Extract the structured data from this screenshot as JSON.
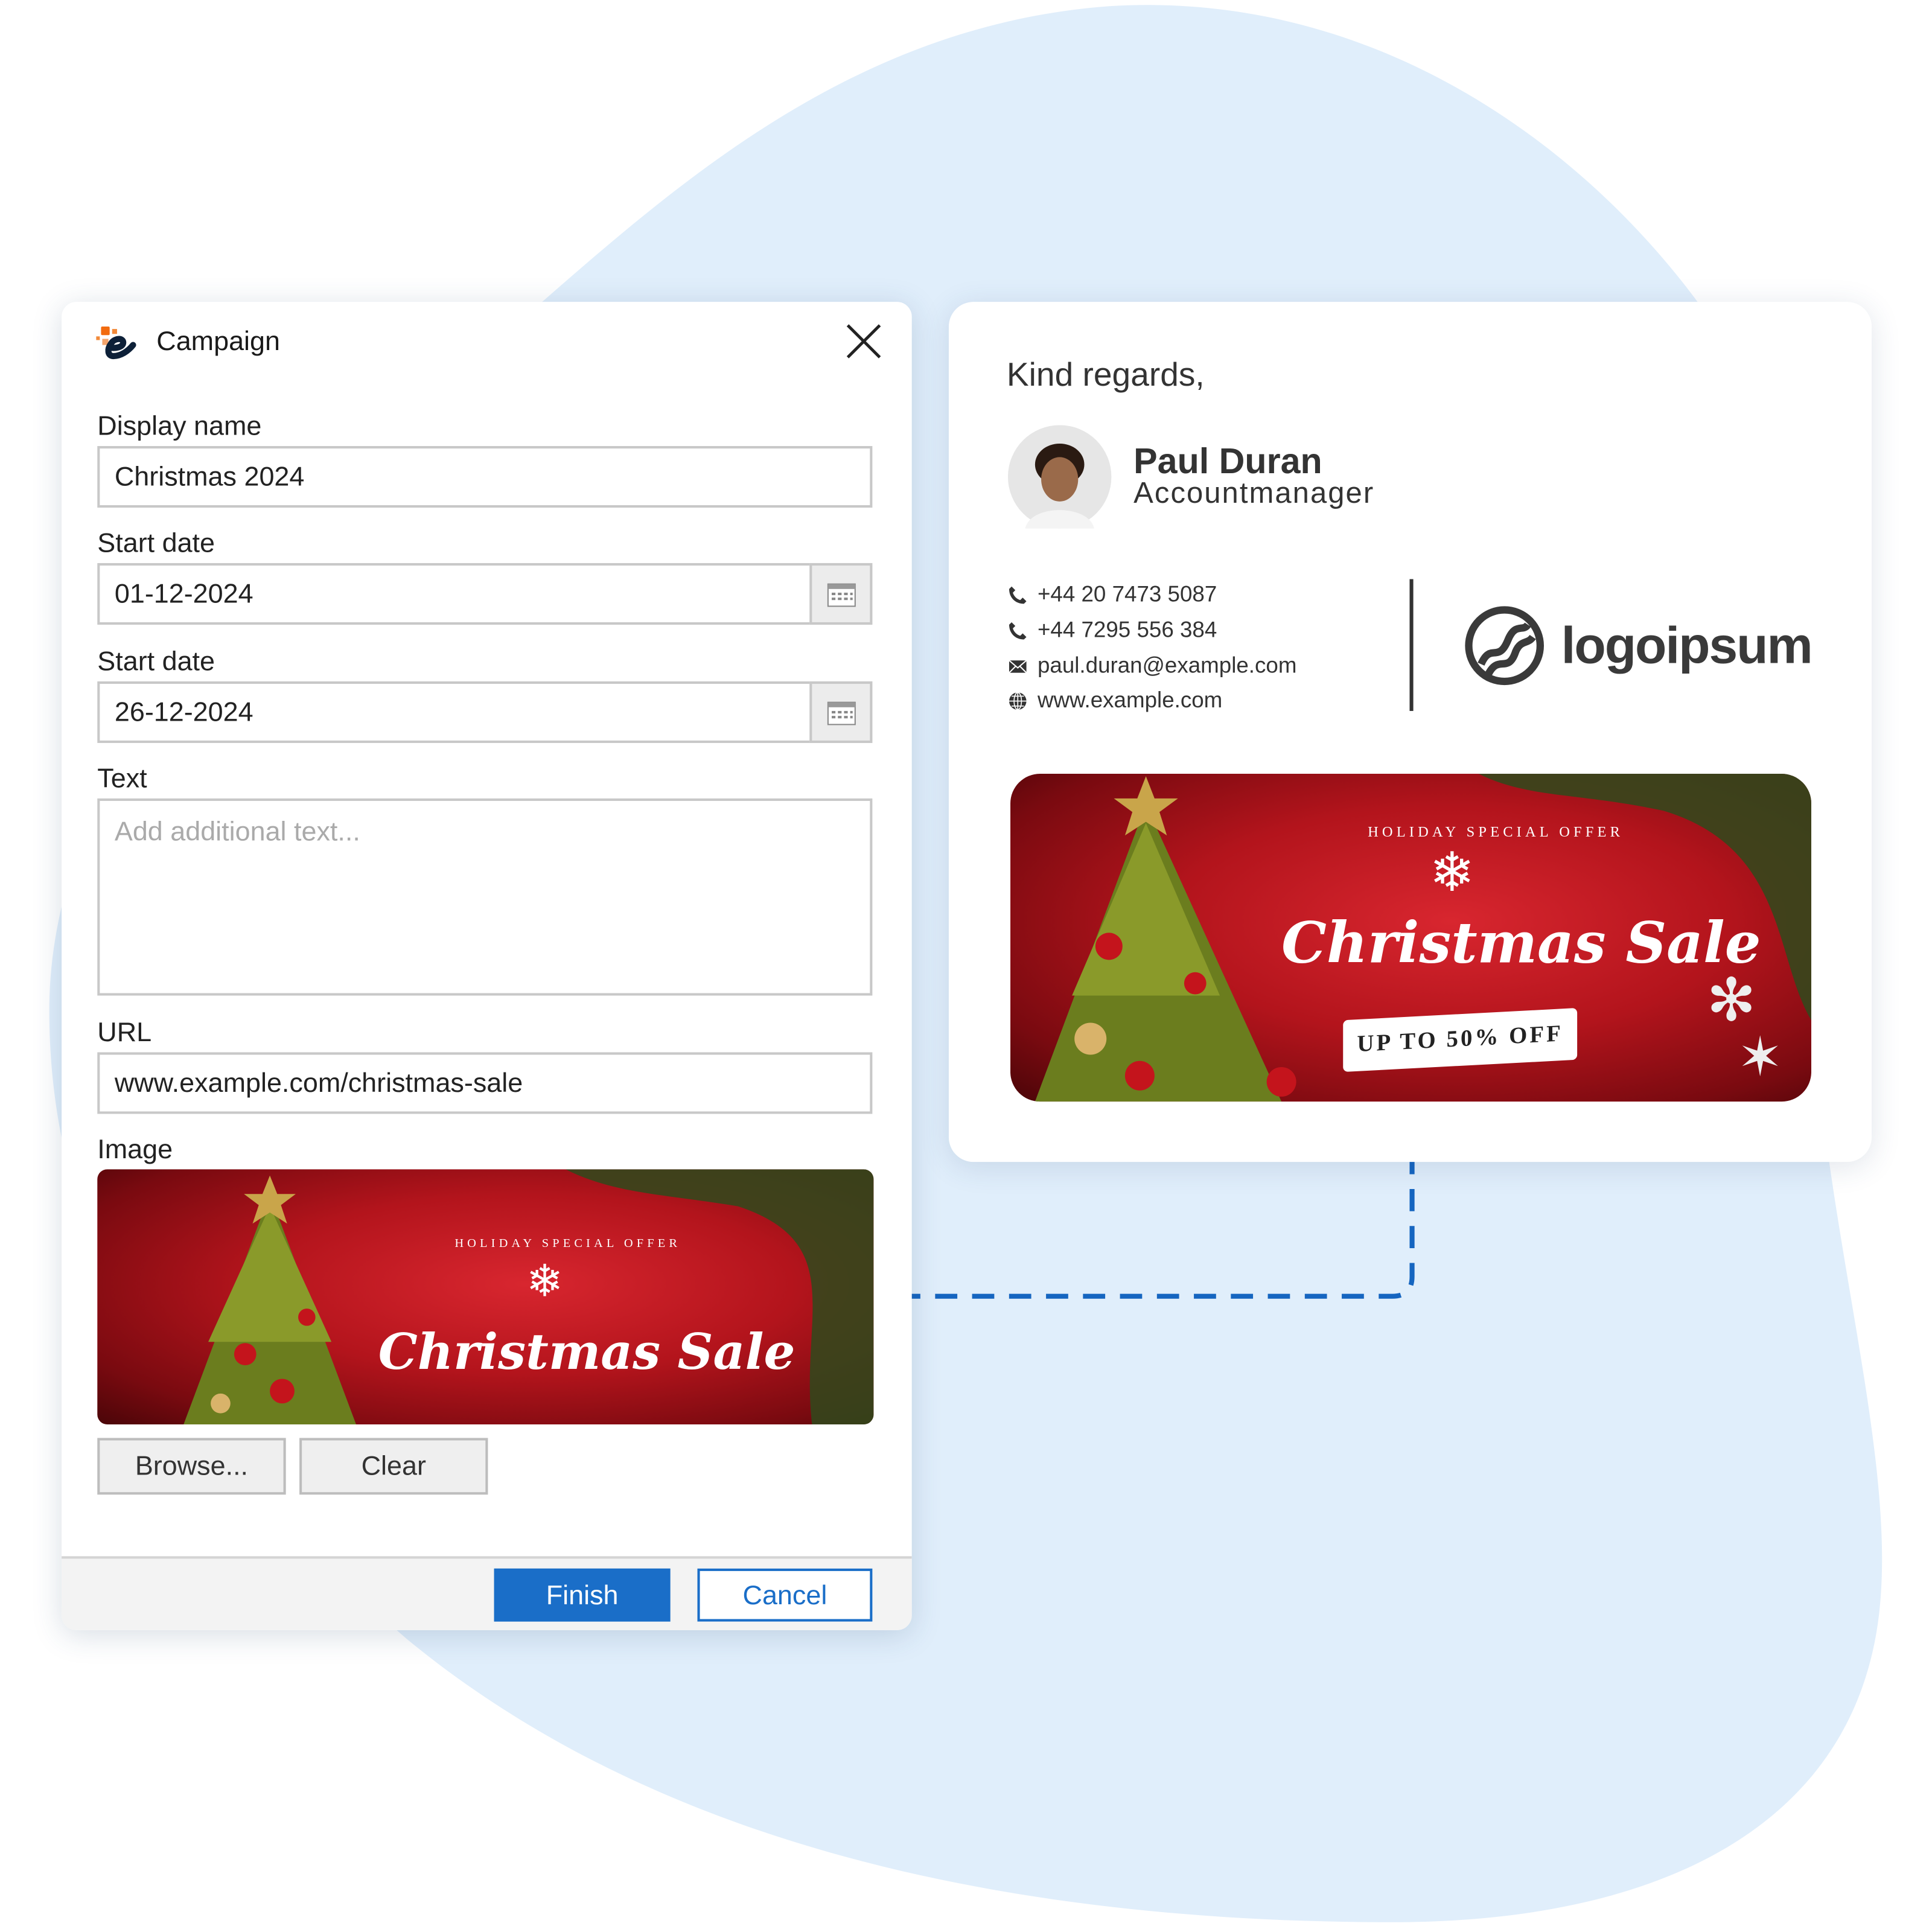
{
  "dialog": {
    "title": "Campaign",
    "fields": {
      "display_name": {
        "label": "Display name",
        "value": "Christmas 2024"
      },
      "start_date": {
        "label": "Start date",
        "value": "01-12-2024"
      },
      "end_date": {
        "label": "Start date",
        "value": "26-12-2024"
      },
      "text": {
        "label": "Text",
        "placeholder": "Add additional text..."
      },
      "url": {
        "label": "URL",
        "value": "www.example.com/christmas-sale"
      },
      "image": {
        "label": "Image"
      }
    },
    "browse_label": "Browse...",
    "clear_label": "Clear",
    "finish_label": "Finish",
    "cancel_label": "Cancel"
  },
  "banner": {
    "arc_text": "HOLIDAY SPECIAL OFFER",
    "headline": "Christmas Sale",
    "ribbon": "UP TO 50% OFF"
  },
  "signature": {
    "greeting": "Kind regards,",
    "name": "Paul Duran",
    "role": "Accountmanager",
    "contacts": [
      {
        "icon": "phone-icon",
        "text": "+44 20 7473 5087"
      },
      {
        "icon": "phone-icon",
        "text": "+44 7295 556 384"
      },
      {
        "icon": "mail-icon",
        "text": "paul.duran@example.com"
      },
      {
        "icon": "globe-icon",
        "text": "www.example.com"
      }
    ],
    "logo_text": "logoipsum"
  },
  "colors": {
    "accent": "#1a6ec8",
    "blob": "#e0eefb",
    "banner_red": "#c41a22",
    "logo": "#3a3a3a"
  }
}
